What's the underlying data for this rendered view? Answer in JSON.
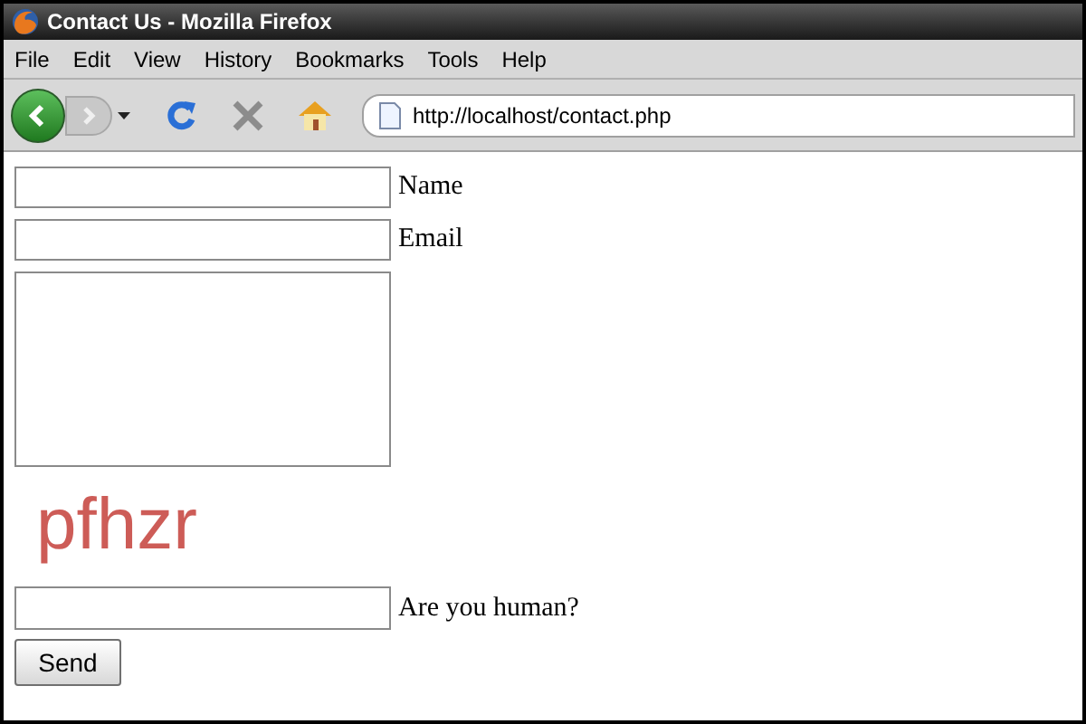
{
  "window": {
    "title": "Contact Us - Mozilla Firefox"
  },
  "menu": [
    "File",
    "Edit",
    "View",
    "History",
    "Bookmarks",
    "Tools",
    "Help"
  ],
  "address": {
    "value": "http://localhost/contact.php"
  },
  "form": {
    "fields": [
      {
        "kind": "input",
        "label": "Name"
      },
      {
        "kind": "input",
        "label": "Email"
      },
      {
        "kind": "textarea"
      }
    ],
    "captcha": "pfhzr",
    "human": {
      "label": "Are you human?"
    },
    "button": "Send"
  }
}
